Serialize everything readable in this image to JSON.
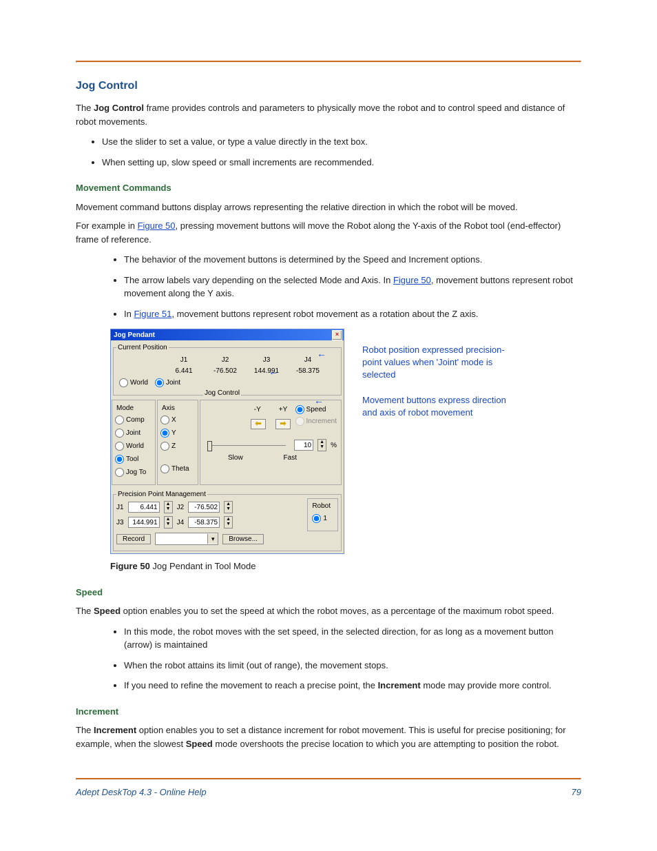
{
  "heading": "Jog Control",
  "intro_pre": "The ",
  "intro_bold": "Jog Control",
  "intro_post": " frame provides controls and parameters to physically move the robot and to control speed and distance of robot movements.",
  "intro_bullets": [
    "Use the slider to set a value, or type a value directly in the text box.",
    "When setting up, slow speed or small increments are recommended."
  ],
  "movement_commands": {
    "title": "Movement Commands",
    "para": "Movement command buttons display arrows representing the relative direction in which the robot will be moved.",
    "example_pre": "For example in ",
    "fig50": "Figure 50",
    "example_post": ", pressing movement buttons will move the Robot along the Y-axis of the Robot tool (end-effector) frame of reference.",
    "bullets": {
      "b1": "The behavior of the movement buttons is determined by the Speed and Increment options.",
      "b2_pre": "The arrow labels vary depending on the selected Mode and Axis. In ",
      "b2_link": "Figure 50",
      "b2_post": ", movement buttons represent robot movement along the Y axis.",
      "b3_pre": "In ",
      "b3_link": "Figure 51",
      "b3_post": ", movement buttons represent robot movement as a rotation about the Z axis."
    }
  },
  "pendant": {
    "title": "Jog Pendant",
    "current_position": {
      "legend": "Current Position",
      "headers": [
        "J1",
        "J2",
        "J3",
        "J4"
      ],
      "values": [
        "6.441",
        "-76.502",
        "144.991",
        "-58.375"
      ],
      "world": "World",
      "joint": "Joint"
    },
    "mode": {
      "label": "Mode",
      "options": [
        "Comp",
        "Joint",
        "World",
        "Tool",
        "Jog To"
      ]
    },
    "axis": {
      "label": "Axis",
      "options": [
        "X",
        "Y",
        "Z",
        "Theta"
      ]
    },
    "jog": {
      "label": "Jog Control",
      "minus": "-Y",
      "plus": "+Y",
      "speed": "Speed",
      "increment": "Increment",
      "value": "10",
      "percent": "%",
      "slow": "Slow",
      "fast": "Fast"
    },
    "ppm": {
      "label": "Precision Point Management",
      "j1_label": "J1",
      "j1": "6.441",
      "j2_label": "J2",
      "j2": "-76.502",
      "j3_label": "J3",
      "j3": "144.991",
      "j4_label": "J4",
      "j4": "-58.375",
      "record": "Record",
      "browse": "Browse..."
    },
    "robot": {
      "label": "Robot",
      "one": "1"
    }
  },
  "figure_caption": {
    "strong": "Figure 50",
    "rest": "  Jog Pendant in Tool Mode"
  },
  "annotations": {
    "a1": "Robot position expressed precision-point values when 'Joint' mode is selected",
    "a2": "Movement buttons express direction and axis of robot movement"
  },
  "speed": {
    "title": "Speed",
    "para_pre": "The ",
    "para_bold": "Speed",
    "para_post": " option enables you to set the speed at which the robot moves, as a percentage of the maximum robot speed.",
    "bullets": {
      "b1": "In this mode, the robot moves with the set speed, in the selected direction, for as long as a movement button (arrow) is maintained",
      "b2": "When the robot attains its limit (out of range), the movement stops.",
      "b3_pre": "If you need to refine the movement to reach a precise point, the ",
      "b3_bold": "Increment",
      "b3_post": " mode may provide more control."
    }
  },
  "increment": {
    "title": "Increment",
    "para_pre": "The ",
    "para_bold1": "Increment",
    "para_mid": " option enables you to set a distance increment for robot movement. This is useful for precise positioning; for example, when the slowest ",
    "para_bold2": "Speed",
    "para_post": " mode overshoots the precise location to which you are attempting to position the robot."
  },
  "footer": {
    "left": "Adept DeskTop 4.3  - Online Help",
    "right": "79"
  }
}
